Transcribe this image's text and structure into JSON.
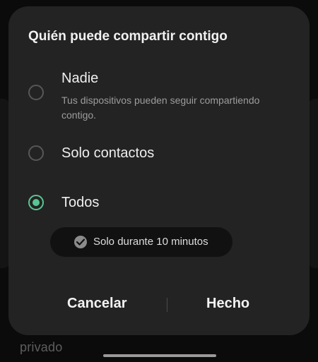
{
  "dialog": {
    "title": "Quién puede compartir contigo",
    "options": [
      {
        "label": "Nadie",
        "description": "Tus dispositivos pueden seguir compartiendo contigo.",
        "selected": false
      },
      {
        "label": "Solo contactos",
        "selected": false
      },
      {
        "label": "Todos",
        "selected": true
      }
    ],
    "duration_chip": {
      "label": "Solo durante 10 minutos",
      "icon": "check-circle-icon"
    },
    "buttons": {
      "cancel": "Cancelar",
      "done": "Hecho"
    }
  },
  "background": {
    "partial_text": "privado"
  },
  "colors": {
    "accent": "#59c592",
    "dialog_bg": "#232323",
    "chip_bg": "#111111"
  }
}
